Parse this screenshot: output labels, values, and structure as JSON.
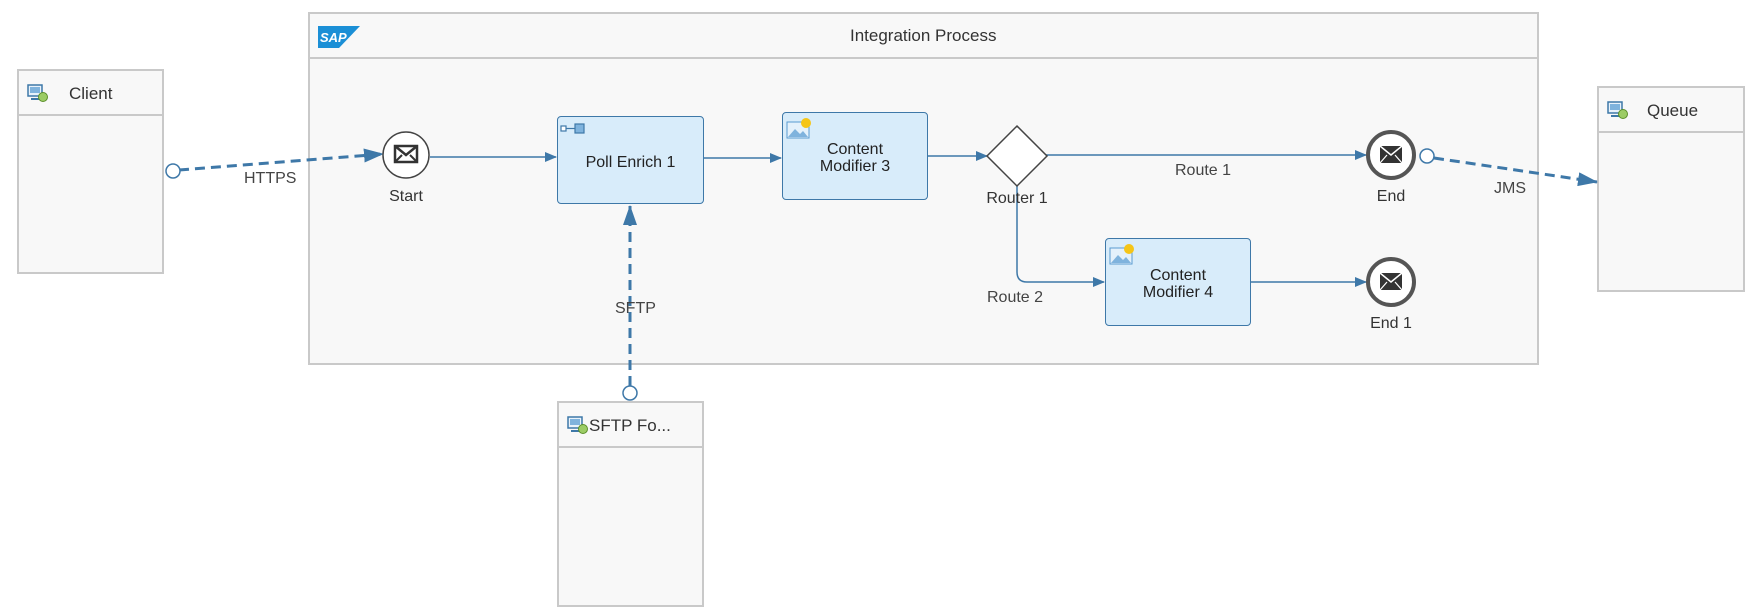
{
  "process": {
    "title": "Integration Process",
    "logo_text": "SAP"
  },
  "participants": {
    "client": "Client",
    "queue": "Queue",
    "sftp": "SFTP Fo..."
  },
  "events": {
    "start": "Start",
    "end": "End",
    "end1": "End 1"
  },
  "tasks": {
    "poll_enrich": "Poll Enrich 1",
    "content_modifier_3": "Content\nModifier 3",
    "content_modifier_4": "Content\nModifier 4"
  },
  "gateways": {
    "router": "Router 1"
  },
  "edges": {
    "https": "HTTPS",
    "jms": "JMS",
    "sftp": "SFTP",
    "route1": "Route 1",
    "route2": "Route 2"
  },
  "colors": {
    "flow": "#3e78a8",
    "task_fill": "#d8ecfa",
    "border": "#c9c9c9",
    "event_stroke": "#555555",
    "sap_blue": "#1b8fd6"
  }
}
